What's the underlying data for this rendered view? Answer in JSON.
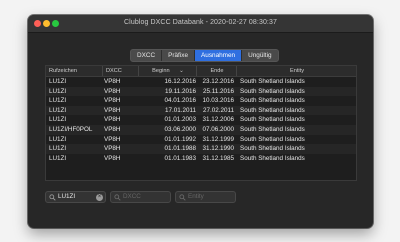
{
  "window": {
    "title": "Clublog DXCC Databank - 2020-02-27 08:30:37"
  },
  "tabs": [
    {
      "label": "DXCC",
      "active": false
    },
    {
      "label": "Präfixe",
      "active": false
    },
    {
      "label": "Ausnahmen",
      "active": true
    },
    {
      "label": "Ungültig",
      "active": false
    }
  ],
  "table": {
    "headers": [
      "Rufzeichen",
      "DXCC",
      "Beginn",
      "Ende",
      "Entity"
    ],
    "sort_indicator": "⌄",
    "rows": [
      [
        "LU1ZI",
        "VP8H",
        "16.12.2016",
        "23.12.2016",
        "South Shetland Islands"
      ],
      [
        "LU1ZI",
        "VP8H",
        "19.11.2016",
        "25.11.2016",
        "South Shetland Islands"
      ],
      [
        "LU1ZI",
        "VP8H",
        "04.01.2016",
        "10.03.2016",
        "South Shetland Islands"
      ],
      [
        "LU1ZI",
        "VP8H",
        "17.01.2011",
        "27.02.2011",
        "South Shetland Islands"
      ],
      [
        "LU1ZI",
        "VP8H",
        "01.01.2003",
        "31.12.2006",
        "South Shetland Islands"
      ],
      [
        "LU1ZI/HF0POL",
        "VP8H",
        "03.06.2000",
        "07.06.2000",
        "South Shetland Islands"
      ],
      [
        "LU1ZI",
        "VP8H",
        "01.01.1992",
        "31.12.1999",
        "South Shetland Islands"
      ],
      [
        "LU1ZI",
        "VP8H",
        "01.01.1988",
        "31.12.1990",
        "South Shetland Islands"
      ],
      [
        "LU1ZI",
        "VP8H",
        "01.01.1983",
        "31.12.1985",
        "South Shetland Islands"
      ]
    ]
  },
  "filters": {
    "callsign": {
      "value": "LU1ZI",
      "placeholder": ""
    },
    "dxcc": {
      "value": "",
      "placeholder": "DXCC"
    },
    "entity": {
      "value": "",
      "placeholder": "Entity"
    },
    "clear_glyph": "×"
  },
  "icons": {
    "search": "search-icon",
    "clear": "clear-icon"
  },
  "colors": {
    "accent": "#2f6fe0",
    "close": "#fe5f57",
    "minimize": "#febc2e",
    "maximize": "#28c840"
  }
}
